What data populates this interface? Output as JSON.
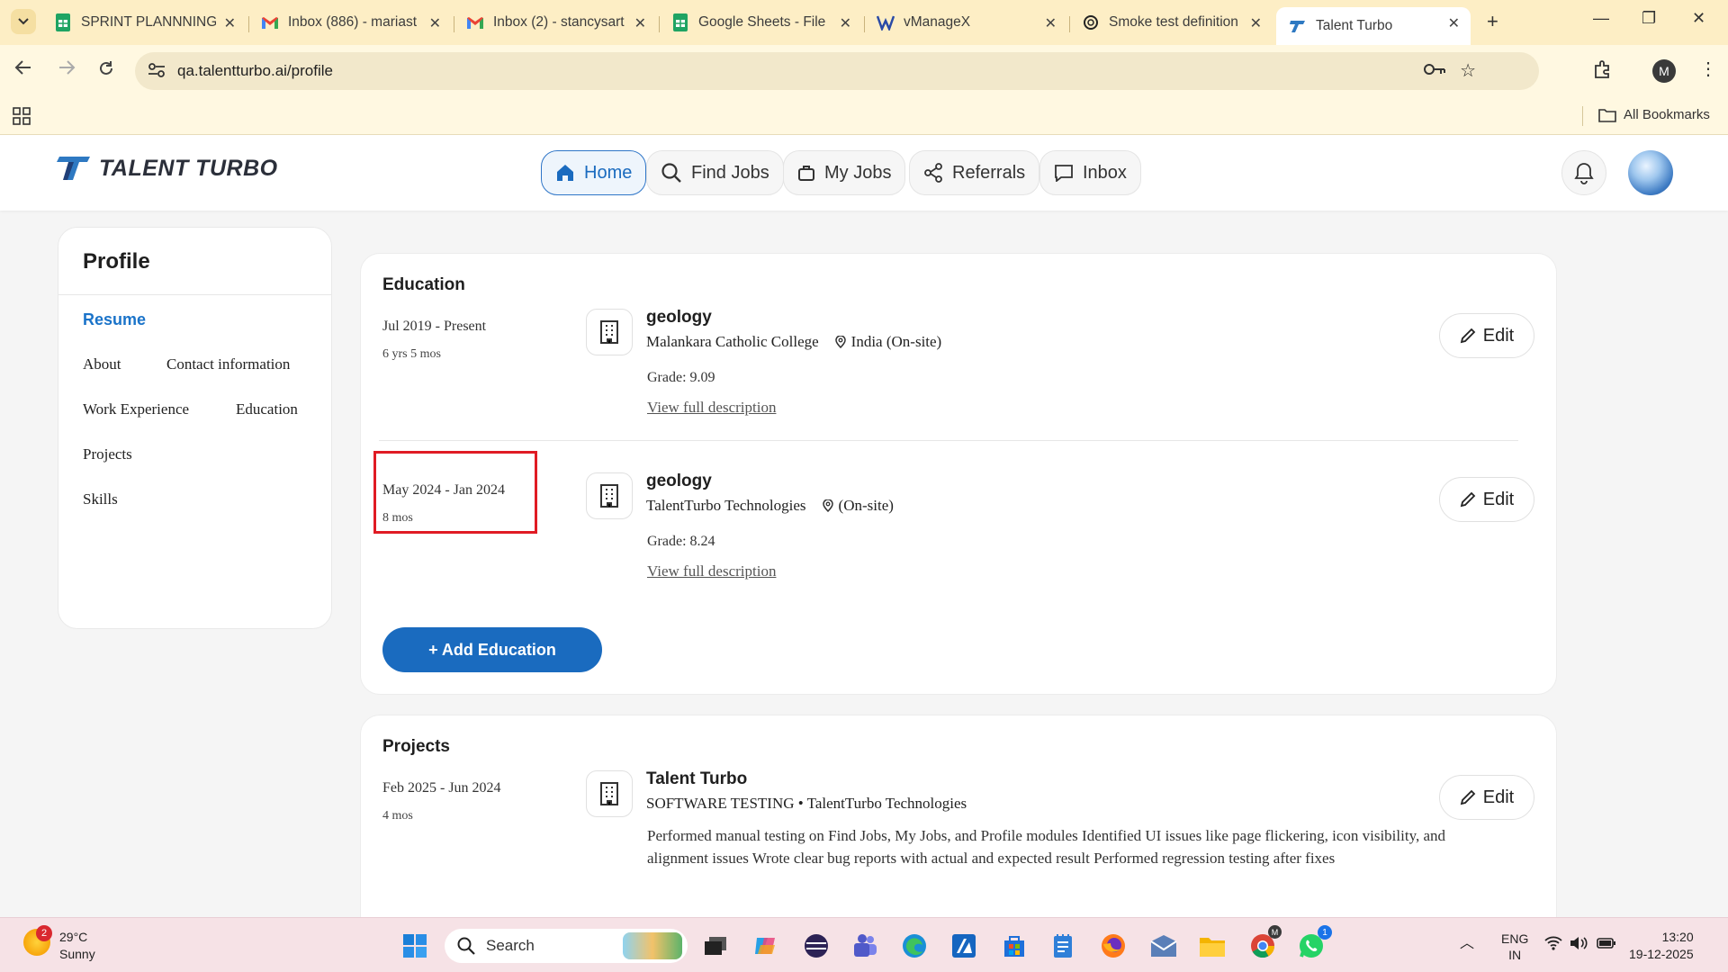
{
  "browser": {
    "tabs": [
      {
        "title": "SPRINT PLANNNING",
        "icon": "sheets-icon"
      },
      {
        "title": "Inbox (886) - mariast",
        "icon": "gmail-icon"
      },
      {
        "title": "Inbox (2) - stancysart",
        "icon": "gmail-icon"
      },
      {
        "title": "Google Sheets - File",
        "icon": "sheets-icon"
      },
      {
        "title": "vManageX",
        "icon": "vmanagex-icon"
      },
      {
        "title": "Smoke test definition",
        "icon": "chatgpt-icon"
      },
      {
        "title": "Talent Turbo",
        "icon": "talent-turbo-icon",
        "active": true
      }
    ],
    "url": "qa.talentturbo.ai/profile",
    "profile_initial": "M",
    "bookmarks_label": "All Bookmarks"
  },
  "app": {
    "logo_text": "TALENT TURBO",
    "nav": [
      {
        "label": "Home",
        "icon": "home-icon",
        "active": true
      },
      {
        "label": "Find Jobs",
        "icon": "search-icon"
      },
      {
        "label": "My Jobs",
        "icon": "briefcase-icon"
      },
      {
        "label": "Referrals",
        "icon": "share-icon"
      },
      {
        "label": "Inbox",
        "icon": "chat-icon"
      }
    ]
  },
  "sidebar": {
    "title": "Profile",
    "active_item": "Resume",
    "items": [
      "About",
      "Contact information",
      "Work Experience",
      "Education",
      "Projects",
      "Skills"
    ]
  },
  "education": {
    "section_title": "Education",
    "entries": [
      {
        "date": "Jul 2019 - Present",
        "duration": "6 yrs 5 mos",
        "title": "geology",
        "institution": "Malankara Catholic College",
        "location": "India (On-site)",
        "grade": "Grade: 9.09",
        "link": "View full description",
        "edit": "Edit"
      },
      {
        "date": "May 2024 - Jan 2024",
        "duration": "8 mos",
        "title": "geology",
        "institution": "TalentTurbo Technologies",
        "location": "(On-site)",
        "grade": "Grade: 8.24",
        "link": "View full description",
        "edit": "Edit"
      }
    ],
    "add_button": "+ Add Education"
  },
  "projects": {
    "section_title": "Projects",
    "entries": [
      {
        "date": "Feb 2025 - Jun 2024",
        "duration": "4 mos",
        "title": "Talent Turbo",
        "subtitle": "SOFTWARE TESTING • TalentTurbo Technologies",
        "description": "Performed manual testing on Find Jobs, My Jobs, and Profile modules Identified UI issues like page flickering, icon visibility, and alignment issues Wrote clear bug reports with actual and expected result Performed regression testing after fixes",
        "edit": "Edit"
      }
    ]
  },
  "taskbar": {
    "weather_temp": "29°C",
    "weather_desc": "Sunny",
    "weather_badge": "2",
    "search_label": "Search",
    "lang_line1": "ENG",
    "lang_line2": "IN",
    "time": "13:20",
    "date": "19-12-2025",
    "chrome_badge": "M",
    "whatsapp_badge": "1"
  },
  "colors": {
    "accent": "#1a6bbf",
    "highlight_box": "#e01b24",
    "tabstrip": "#fdeec5",
    "taskbar": "#f6e2e6"
  }
}
